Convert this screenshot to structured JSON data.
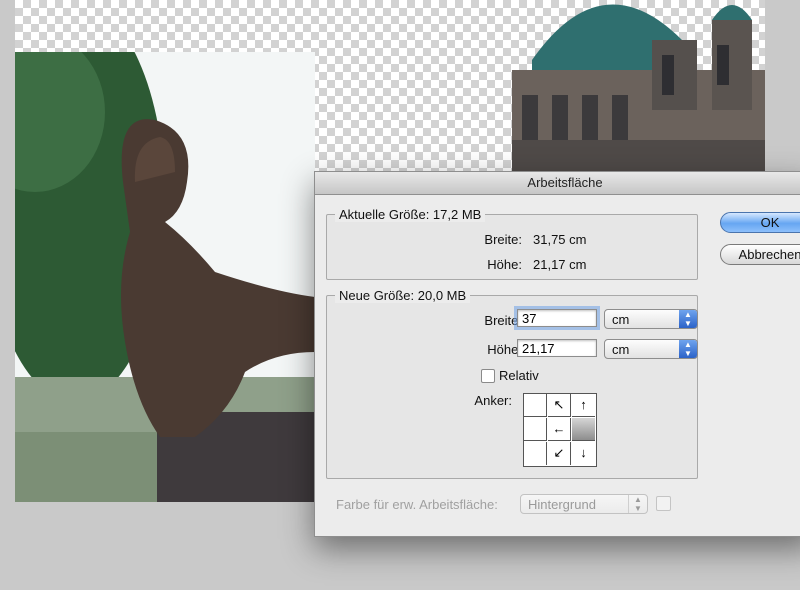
{
  "dialog": {
    "title": "Arbeitsfläche",
    "current": {
      "legend": "Aktuelle Größe: 17,2 MB",
      "width_label": "Breite:",
      "width_value": "31,75 cm",
      "height_label": "Höhe:",
      "height_value": "21,17 cm"
    },
    "new": {
      "legend": "Neue Größe: 20,0 MB",
      "width_label": "Breite:",
      "width_value": "37",
      "width_unit": "cm",
      "height_label": "Höhe:",
      "height_value": "21,17",
      "height_unit": "cm",
      "relative_label": "Relativ",
      "relative_checked": false,
      "anchor_label": "Anker:",
      "anchor_cells": [
        "",
        "↖",
        "↑",
        "",
        "←",
        "",
        "",
        "↙",
        "↓"
      ]
    },
    "extension_color": {
      "label": "Farbe für erw. Arbeitsfläche:",
      "value": "Hintergrund"
    },
    "buttons": {
      "ok": "OK",
      "cancel": "Abbrechen"
    }
  },
  "colors": {
    "accent": "#5e9ef0",
    "canvas_bg": "#c9c9c9",
    "dialog_bg": "#ececec"
  }
}
